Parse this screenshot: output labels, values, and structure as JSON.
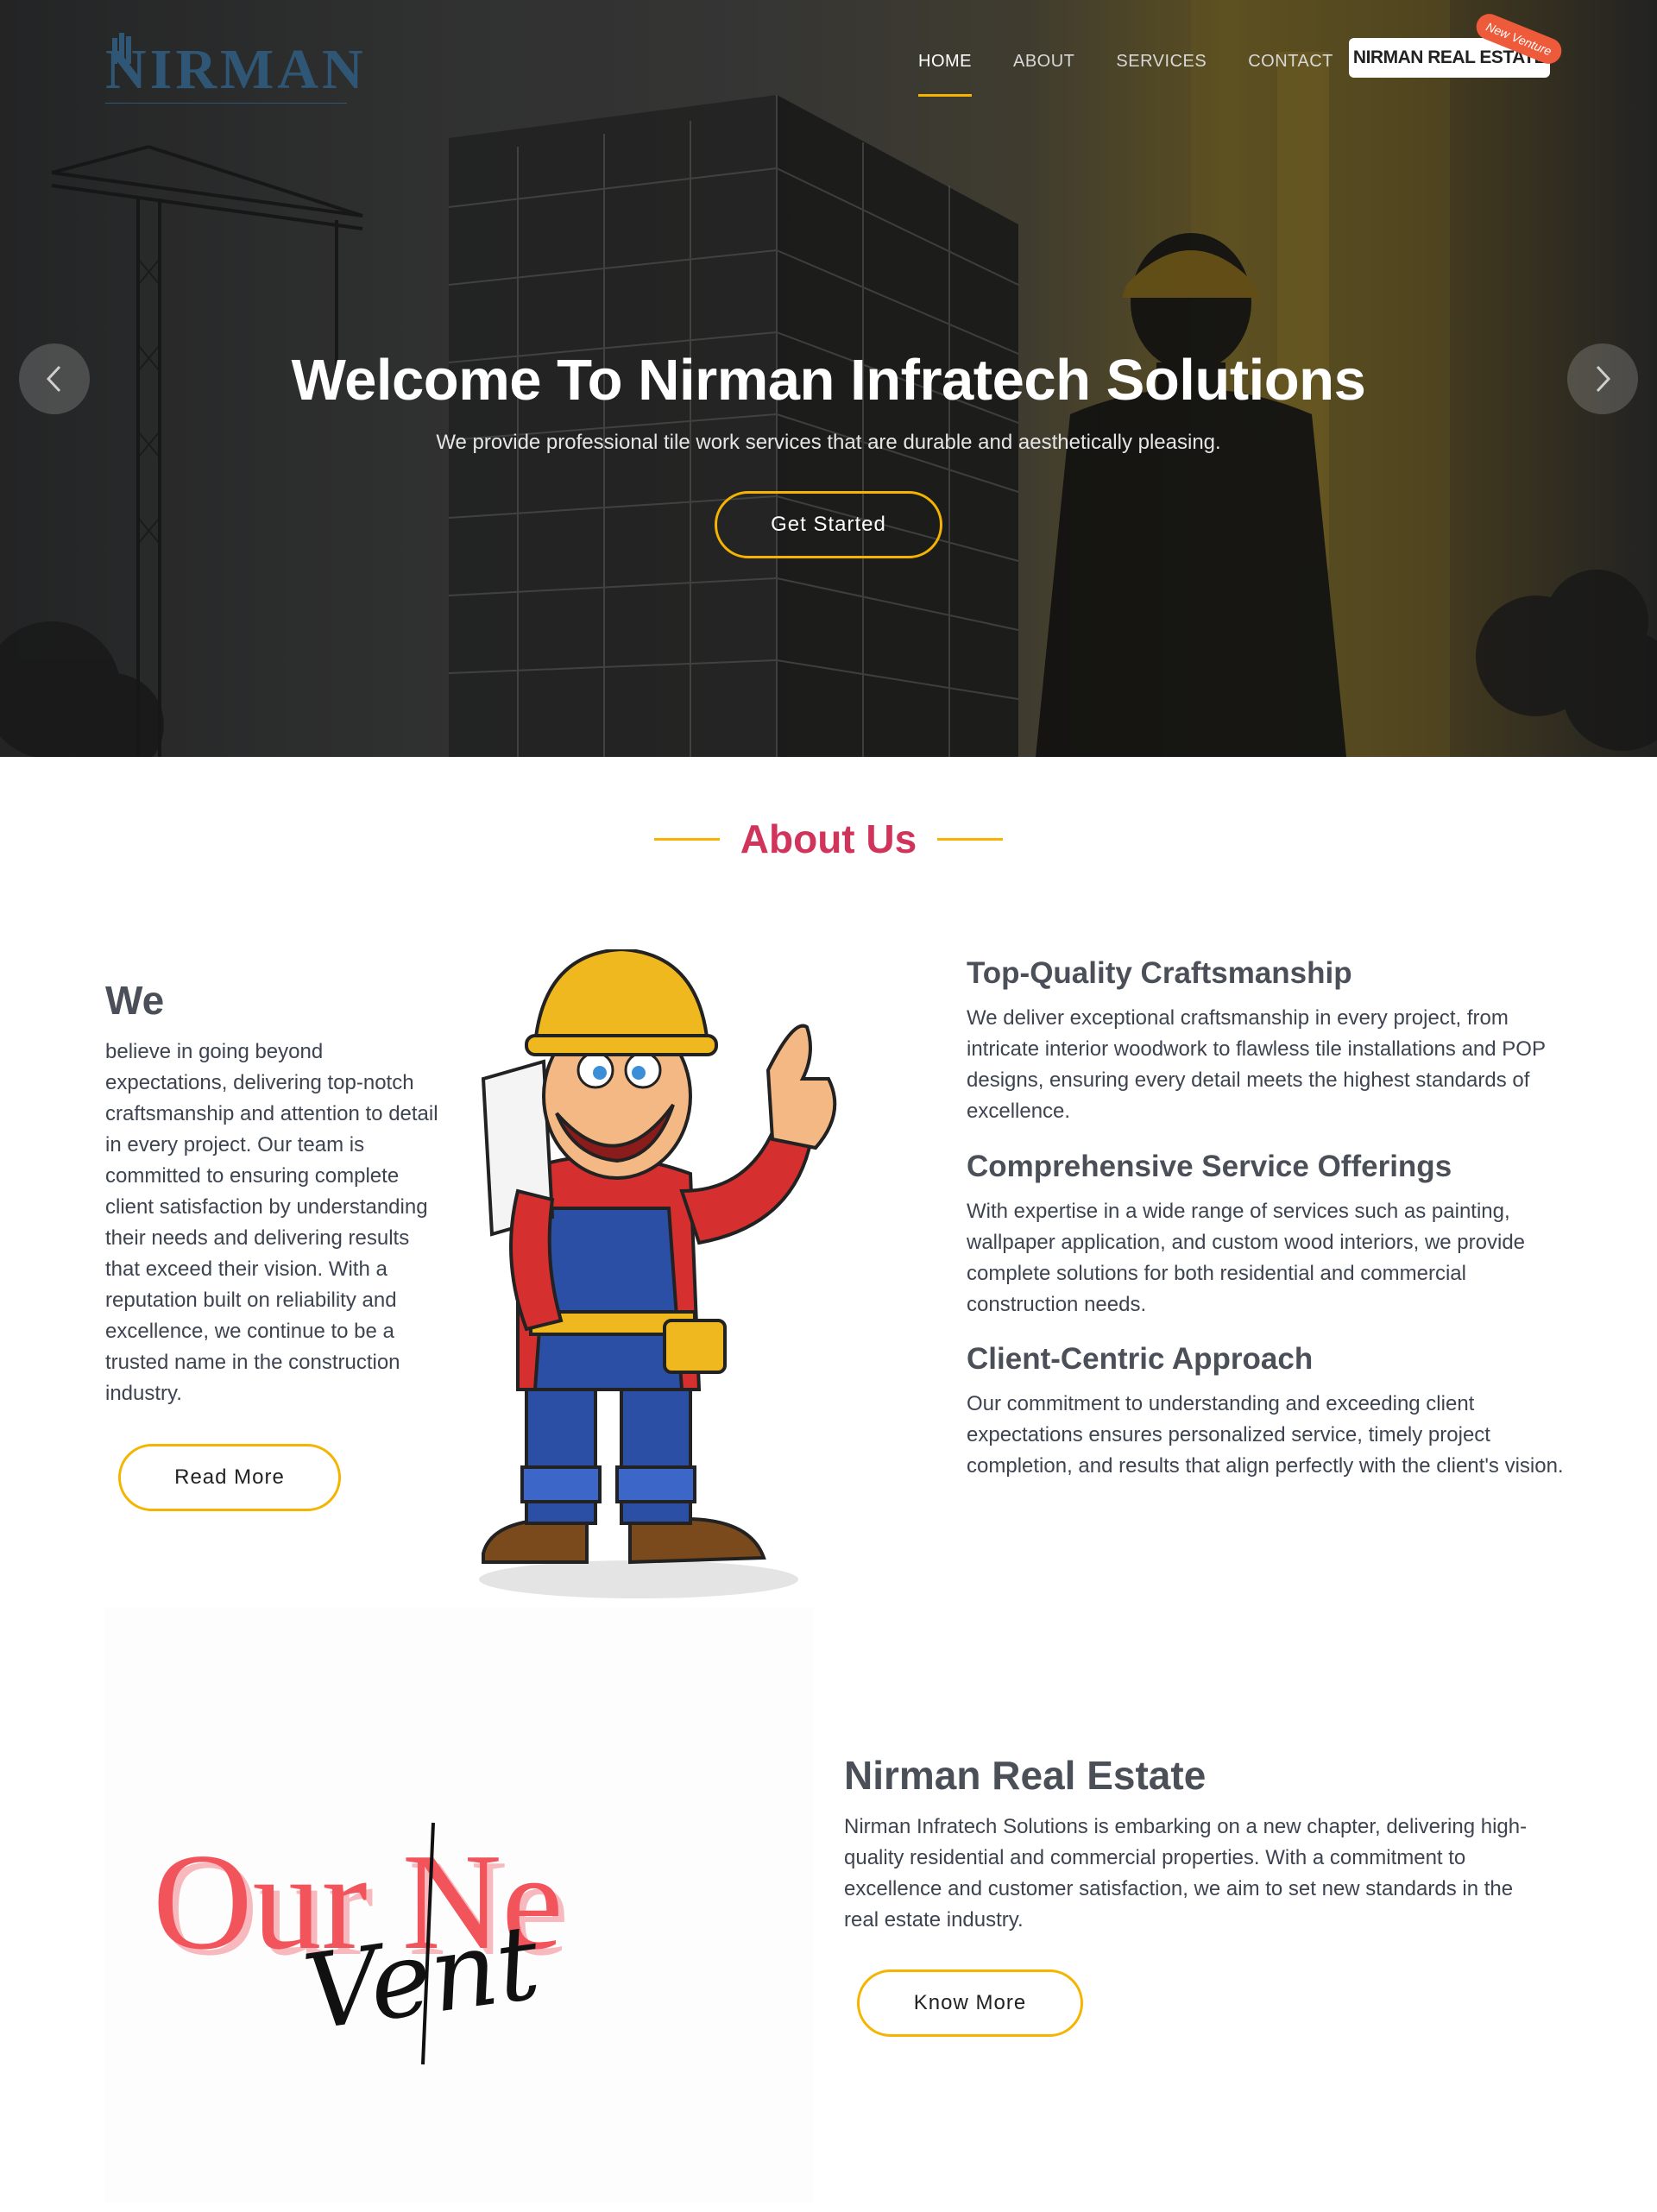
{
  "brand": {
    "logo_text": "NIRMAN"
  },
  "nav": {
    "items": [
      "HOME",
      "ABOUT",
      "SERVICES",
      "CONTACT"
    ],
    "real_estate_button": "NIRMAN REAL ESTATE",
    "badge": "New Venture"
  },
  "hero": {
    "title": "Welcome To Nirman Infratech Solutions",
    "subtitle": "We provide professional tile work services that are durable and aesthetically pleasing.",
    "cta_label": "Get Started"
  },
  "about": {
    "section_title": "About Us",
    "we_heading": "We",
    "we_text": "believe in going beyond expectations, delivering top-notch craftsmanship and attention to detail in every project. Our team is committed to ensuring complete client satisfaction by understanding their needs and delivering results that exceed their vision. With a reputation built on reliability and excellence, we continue to be a trusted name in the construction industry.",
    "read_more_label": "Read More",
    "features": [
      {
        "title": "Top-Quality Craftsmanship",
        "text": "We deliver exceptional craftsmanship in every project, from intricate interior woodwork to flawless tile installations and POP designs, ensuring every detail meets the highest standards of excellence."
      },
      {
        "title": "Comprehensive Service Offerings",
        "text": "With expertise in a wide range of services such as painting, wallpaper application, and custom wood interiors, we provide complete solutions for both residential and commercial construction needs."
      },
      {
        "title": "Client-Centric Approach",
        "text": "Our commitment to understanding and exceeding client expectations ensures personalized service, timely project completion, and results that align perfectly with the client's vision."
      }
    ]
  },
  "real_estate": {
    "image_text_main": "Our Ne",
    "image_text_script": "Vent",
    "heading": "Nirman Real Estate",
    "text": "Nirman Infratech Solutions is embarking on a new chapter, delivering high-quality residential and commercial properties. With a commitment to excellence and customer satisfaction, we aim to set new standards in the real estate industry.",
    "know_more_label": "Know More"
  },
  "colors": {
    "accent": "#f4b400",
    "section_title": "#d1345b",
    "badge": "#ee5b3a",
    "logo": "#2f5775"
  }
}
